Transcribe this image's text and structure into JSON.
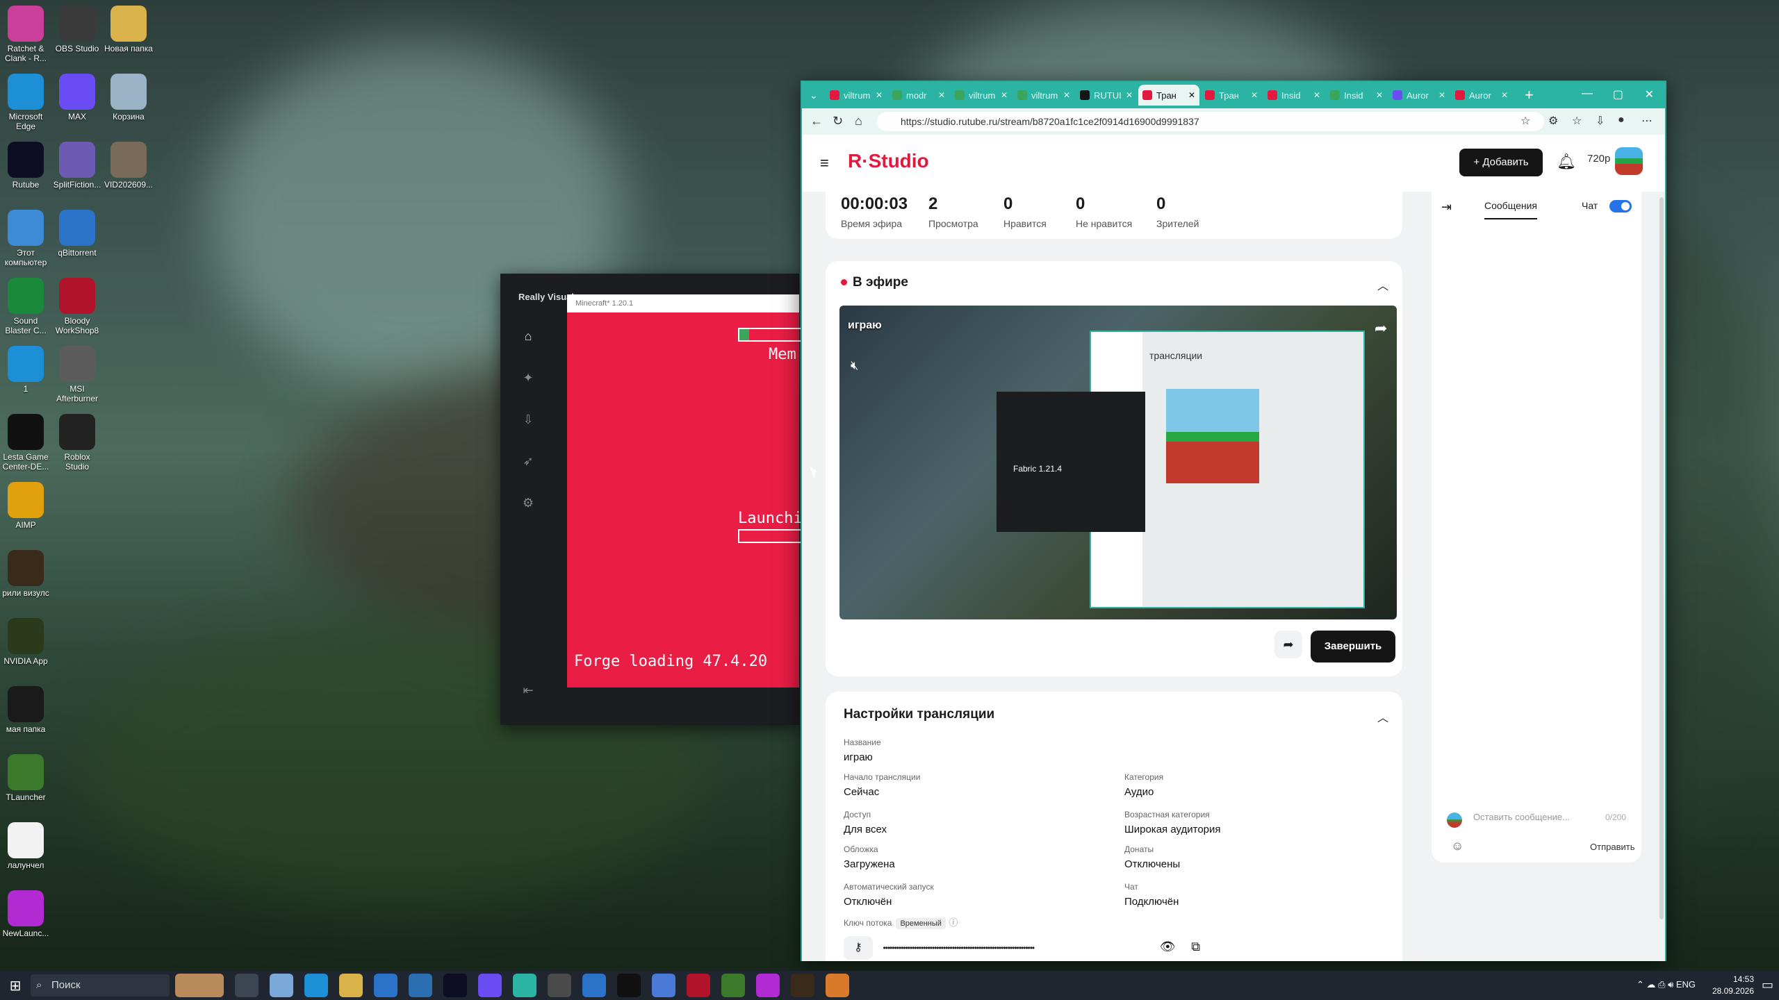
{
  "desktop_icons": [
    {
      "label": "Ratchet & Clank - R...",
      "icon": "ratchet-icon",
      "color": "#c93f9a"
    },
    {
      "label": "OBS Studio",
      "icon": "obs-icon",
      "color": "#3a3a3a"
    },
    {
      "label": "Новая папка",
      "icon": "folder-icon",
      "color": "#d9b24a"
    },
    {
      "label": "Microsoft Edge",
      "icon": "edge-icon",
      "color": "#1c8fd6"
    },
    {
      "label": "MAX",
      "icon": "max-icon",
      "color": "#6a4df2"
    },
    {
      "label": "Корзина",
      "icon": "trash-icon",
      "color": "#9ab3c6"
    },
    {
      "label": "Rutube",
      "icon": "rutube-icon",
      "color": "#0d0d24"
    },
    {
      "label": "SplitFiction...",
      "icon": "splitfiction-icon",
      "color": "#6d5ab2"
    },
    {
      "label": "VID202609...",
      "icon": "video-file-icon",
      "color": "#7a6a5a"
    },
    {
      "label": "Этот компьютер",
      "icon": "computer-icon",
      "color": "#3d8bd6"
    },
    {
      "label": "qBittorrent",
      "icon": "qbittorrent-icon",
      "color": "#2a73c9"
    },
    {
      "label": "Sound Blaster C...",
      "icon": "soundblaster-icon",
      "color": "#1a8a3a"
    },
    {
      "label": "Bloody WorkShop8",
      "icon": "bloody-icon",
      "color": "#b1132a"
    },
    {
      "label": "1",
      "icon": "edge-icon",
      "color": "#1c8fd6"
    },
    {
      "label": "MSI Afterburner",
      "icon": "afterburner-icon",
      "color": "#5c5c5c"
    },
    {
      "label": "Lesta Game Center-DE...",
      "icon": "lesta-icon",
      "color": "#111111"
    },
    {
      "label": "Roblox Studio",
      "icon": "roblox-icon",
      "color": "#222222"
    },
    {
      "label": "AIMP",
      "icon": "aimp-icon",
      "color": "#e1a10d"
    },
    {
      "label": "рили визулс",
      "icon": "rv-icon",
      "color": "#3a2a1a"
    },
    {
      "label": "NVIDIA App",
      "icon": "nvidia-icon",
      "color": "#2a3a1a"
    },
    {
      "label": "мая папка",
      "icon": "folder-icon",
      "color": "#1a1a1a"
    },
    {
      "label": "TLauncher",
      "icon": "tlauncher-icon",
      "color": "#3a7a2a"
    },
    {
      "label": "лалунчел",
      "icon": "file-icon",
      "color": "#f2f2f2"
    },
    {
      "label": "NewLaunc...",
      "icon": "newlauncher-icon",
      "color": "#b12ad2"
    }
  ],
  "launcher": {
    "title": "Really Visuals",
    "mc_title": "Minecraft* 1.20.1",
    "mem_text": "Mem",
    "launch_text": "Launchi",
    "forge_text": "Forge loading 47.4.20"
  },
  "browser": {
    "tabs": [
      {
        "label": "viltrum",
        "fav": "#e3183f",
        "active": false
      },
      {
        "label": "modr",
        "fav": "#3ca55c",
        "active": false
      },
      {
        "label": "viltrum",
        "fav": "#3ca55c",
        "active": false
      },
      {
        "label": "viltrum",
        "fav": "#3ca55c",
        "active": false
      },
      {
        "label": "RUTUI",
        "fav": "#151515",
        "active": false
      },
      {
        "label": "Тран",
        "fav": "#e3183f",
        "active": true
      },
      {
        "label": "Тран",
        "fav": "#e3183f",
        "active": false
      },
      {
        "label": "Insid",
        "fav": "#e3183f",
        "active": false
      },
      {
        "label": "Insid",
        "fav": "#3ca55c",
        "active": false
      },
      {
        "label": "Auror",
        "fav": "#6a4df2",
        "active": false
      },
      {
        "label": "Auror",
        "fav": "#e3183f",
        "active": false
      }
    ],
    "url": "https://studio.rutube.ru/stream/b8720a1fc1ce2f0914d16900d9991837"
  },
  "studio": {
    "logo_r": "R",
    "logo_dot": "·",
    "logo_text": "Studio",
    "add_label": "Добавить",
    "quality": "720p",
    "stats": [
      {
        "value": "00:00:03",
        "label": "Время эфира"
      },
      {
        "value": "2",
        "label": "Просмотра"
      },
      {
        "value": "0",
        "label": "Нравится"
      },
      {
        "value": "0",
        "label": "Не нравится"
      },
      {
        "value": "0",
        "label": "Зрителей"
      }
    ],
    "live_title": "В эфире",
    "video_label": "играю",
    "mini_fabric": "Fabric 1.21.4",
    "mini_heading": "трансляции",
    "end_label": "Завершить",
    "settings_title": "Настройки трансляции",
    "fields": {
      "name": {
        "k": "Название",
        "v": "играю"
      },
      "start": {
        "k": "Начало трансляции",
        "v": "Сейчас"
      },
      "category": {
        "k": "Категория",
        "v": "Аудио"
      },
      "access": {
        "k": "Доступ",
        "v": "Для всех"
      },
      "age": {
        "k": "Возрастная категория",
        "v": "Широкая аудитория"
      },
      "cover": {
        "k": "Обложка",
        "v": "Загружена"
      },
      "donates": {
        "k": "Донаты",
        "v": "Отключены"
      },
      "autostart": {
        "k": "Автоматический запуск",
        "v": "Отключён"
      },
      "chat": {
        "k": "Чат",
        "v": "Подключён"
      }
    },
    "key_label": "Ключ потока",
    "key_badge": "Временный",
    "key_mask": "••••••••••••••••••••••••••••••••••••••••••••••••••••••••••••••••••••",
    "chat_tab": "Сообщения",
    "chat_toggle": "Чат",
    "chat_placeholder": "Оставить сообщение...",
    "chat_counter": "0/200",
    "send_label": "Отправить"
  },
  "taskbar": {
    "search": "Поиск",
    "lang": "ENG",
    "time": "14:53",
    "date": "28.09.2026"
  }
}
